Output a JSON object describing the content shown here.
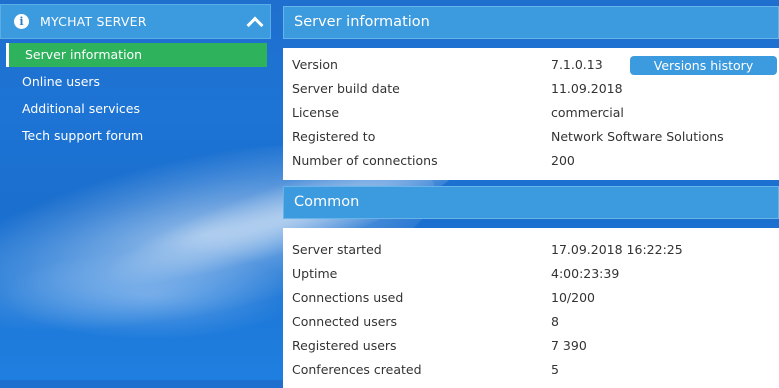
{
  "sidebar": {
    "title": "MYCHAT SERVER",
    "items": [
      {
        "label": "Server information"
      },
      {
        "label": "Online users"
      },
      {
        "label": "Additional services"
      },
      {
        "label": "Tech support forum"
      }
    ]
  },
  "server_info": {
    "title": "Server information",
    "versions_button": "Versions history",
    "rows": [
      {
        "label": "Version",
        "value": "7.1.0.13"
      },
      {
        "label": "Server build date",
        "value": "11.09.2018"
      },
      {
        "label": "License",
        "value": "commercial"
      },
      {
        "label": "Registered to",
        "value": "Network Software Solutions"
      },
      {
        "label": "Number of connections",
        "value": "200"
      }
    ]
  },
  "common": {
    "title": "Common",
    "rows": [
      {
        "label": "Server started",
        "value": "17.09.2018 16:22:25"
      },
      {
        "label": "Uptime",
        "value": "4:00:23:39"
      },
      {
        "label": "Connections used",
        "value": "10/200"
      },
      {
        "label": "Connected users",
        "value": "8"
      },
      {
        "label": "Registered users",
        "value": "7 390"
      },
      {
        "label": "Conferences created",
        "value": "5"
      }
    ]
  },
  "colors": {
    "header_bg": "#3c9ade",
    "active_item": "#2eb25c",
    "background": "#1d74d4"
  }
}
